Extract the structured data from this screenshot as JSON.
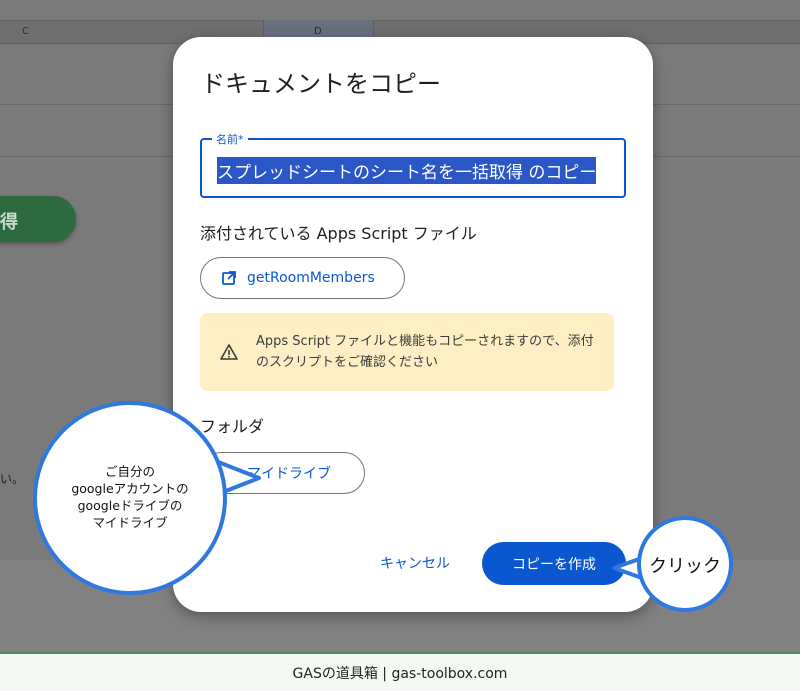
{
  "sheet": {
    "columns": [
      "C",
      "D"
    ],
    "run_button_label": "得",
    "text_fragment": "い。"
  },
  "dialog": {
    "title": "ドキュメントをコピー",
    "name_field": {
      "label": "名前*",
      "value": "スプレッドシートのシート名を一括取得 のコピー"
    },
    "attached_label": "添付されている Apps Script ファイル",
    "script_button": {
      "label": "getRoomMembers",
      "icon": "open-in-new-icon"
    },
    "warning": {
      "icon": "warning-icon",
      "text": "Apps Script ファイルと機能もコピーされますので、添付のスクリプトをご確認ください"
    },
    "folder_label": "フォルダ",
    "folder_button": {
      "label": "マイドライブ",
      "icon": "folder-icon"
    },
    "cancel_label": "キャンセル",
    "copy_label": "コピーを作成"
  },
  "annotations": {
    "drive_note": [
      "ご自分の",
      "googleアカウントの",
      "googleドライブの",
      "マイドライブ"
    ],
    "click_note": "クリック"
  },
  "footer": {
    "text": "GASの道具箱 | gas-toolbox.com"
  },
  "colors": {
    "accent": "#0b57d0",
    "warning_bg": "#fdefc3",
    "bubble_border": "#2e78e0",
    "footer_border": "#4c8b6a"
  }
}
